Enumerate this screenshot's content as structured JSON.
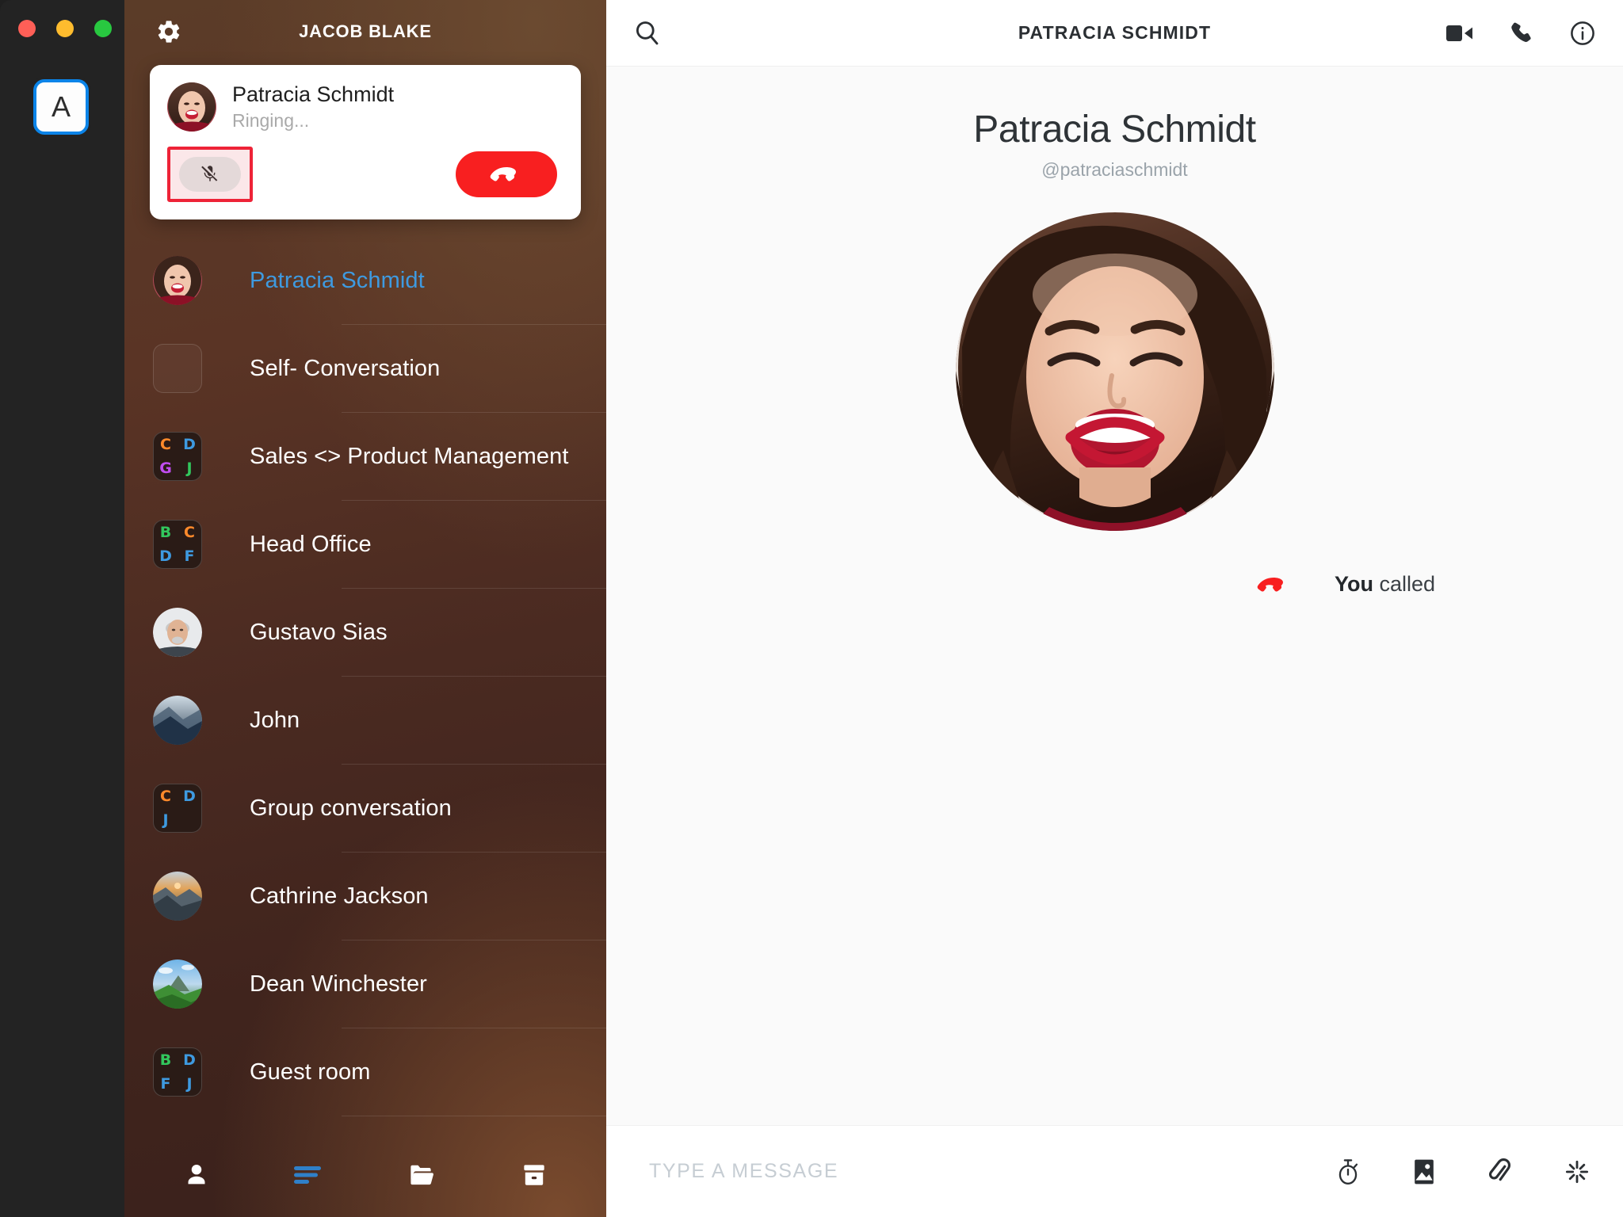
{
  "window": {
    "traffic_lights": [
      "close",
      "minimize",
      "zoom"
    ],
    "account_tile_label": "A"
  },
  "sidebar": {
    "gear_icon": "gear-icon",
    "account_name": "JACOB BLAKE",
    "call_card": {
      "contact_name": "Patracia Schmidt",
      "status": "Ringing...",
      "mute_label": "mute-microphone",
      "hangup_label": "end-call",
      "highlight_color": "#ee2337"
    },
    "conversations": [
      {
        "name": "Patracia Schmidt",
        "avatar_type": "photo-woman",
        "active": true,
        "letters": []
      },
      {
        "name": "Self- Conversation",
        "avatar_type": "blank",
        "active": false,
        "letters": []
      },
      {
        "name": "Sales <> Product Management",
        "avatar_type": "letters",
        "active": false,
        "letters": [
          {
            "c": "C",
            "color": "#ff8a2b"
          },
          {
            "c": "D",
            "color": "#3e9ae0"
          },
          {
            "c": "G",
            "color": "#c04df0"
          },
          {
            "c": "J",
            "color": "#32c75d"
          }
        ]
      },
      {
        "name": "Head Office",
        "avatar_type": "letters",
        "active": false,
        "letters": [
          {
            "c": "B",
            "color": "#32c75d"
          },
          {
            "c": "C",
            "color": "#ff8a2b"
          },
          {
            "c": "D",
            "color": "#3e9ae0"
          },
          {
            "c": "F",
            "color": "#3e9ae0"
          }
        ]
      },
      {
        "name": "Gustavo Sias",
        "avatar_type": "photo-man",
        "active": false,
        "letters": []
      },
      {
        "name": "John",
        "avatar_type": "photo-mountain-blue",
        "active": false,
        "letters": []
      },
      {
        "name": "Group conversation",
        "avatar_type": "letters",
        "active": false,
        "letters": [
          {
            "c": "C",
            "color": "#ff8a2b"
          },
          {
            "c": "D",
            "color": "#3e9ae0"
          },
          {
            "c": "J",
            "color": "#3e9ae0"
          }
        ]
      },
      {
        "name": "Cathrine Jackson",
        "avatar_type": "photo-sunrise",
        "active": false,
        "letters": []
      },
      {
        "name": "Dean Winchester",
        "avatar_type": "photo-green-valley",
        "active": false,
        "letters": []
      },
      {
        "name": "Guest room",
        "avatar_type": "letters",
        "active": false,
        "letters": [
          {
            "c": "B",
            "color": "#32c75d"
          },
          {
            "c": "D",
            "color": "#3e9ae0"
          },
          {
            "c": "F",
            "color": "#3e9ae0"
          },
          {
            "c": "J",
            "color": "#3e9ae0"
          }
        ]
      }
    ],
    "tabs": [
      {
        "icon": "person-icon",
        "active": false
      },
      {
        "icon": "conversations-icon",
        "active": true
      },
      {
        "icon": "folder-icon",
        "active": false
      },
      {
        "icon": "archive-icon",
        "active": false
      }
    ],
    "tab_active_color": "#2f80c9"
  },
  "main": {
    "header": {
      "search_icon": "search-icon",
      "title": "PATRACIA SCHMIDT",
      "actions": [
        {
          "icon": "video-camera-icon"
        },
        {
          "icon": "phone-icon"
        },
        {
          "icon": "info-icon"
        }
      ]
    },
    "profile": {
      "name": "Patracia Schmidt",
      "handle": "@patraciaschmidt",
      "avatar": "photo-woman"
    },
    "system_message": {
      "icon": "call-ended-icon",
      "bold": "You",
      "rest": " called",
      "icon_color": "#f81f20"
    },
    "composer": {
      "placeholder": "TYPE A MESSAGE",
      "value": "",
      "icons": [
        {
          "icon": "timer-icon"
        },
        {
          "icon": "image-icon"
        },
        {
          "icon": "attachment-icon"
        },
        {
          "icon": "ping-icon"
        }
      ]
    }
  }
}
